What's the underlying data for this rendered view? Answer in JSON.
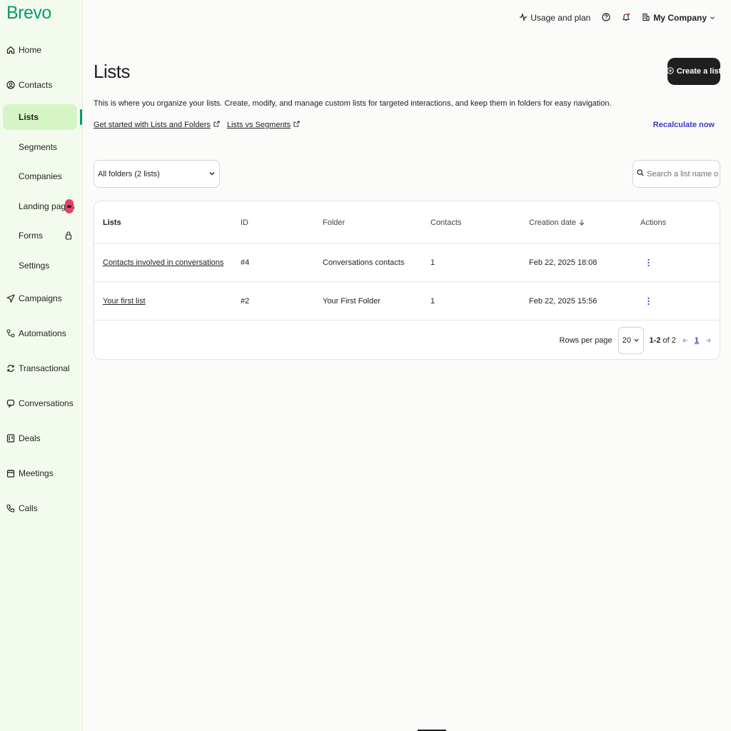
{
  "brand": {
    "logo_text": "Brevo",
    "accent": "#0b996e"
  },
  "sidebar": {
    "items": [
      {
        "label": "Home",
        "icon": "home-icon"
      },
      {
        "label": "Contacts",
        "icon": "contacts-icon"
      },
      {
        "label": "Campaigns",
        "icon": "send-icon"
      },
      {
        "label": "Automations",
        "icon": "automation-icon"
      },
      {
        "label": "Transactional",
        "icon": "refresh-icon"
      },
      {
        "label": "Conversations",
        "icon": "chat-icon"
      },
      {
        "label": "Deals",
        "icon": "deals-icon"
      },
      {
        "label": "Meetings",
        "icon": "calendar-icon"
      },
      {
        "label": "Calls",
        "icon": "phone-icon"
      }
    ],
    "contacts_sub": [
      {
        "label": "Lists",
        "active": true
      },
      {
        "label": "Segments"
      },
      {
        "label": "Companies"
      },
      {
        "label": "Landing pages",
        "badge": "crown-icon"
      },
      {
        "label": "Forms",
        "badge": "lock-icon"
      },
      {
        "label": "Settings"
      }
    ]
  },
  "topbar": {
    "usage_label": "Usage and plan",
    "help_icon": "help-icon",
    "bell_icon": "bell-icon",
    "company_label": "My Company"
  },
  "page": {
    "title": "Lists",
    "create_button": "Create a list",
    "description": "This is where you organize your lists. Create, modify, and manage custom lists for targeted interactions, and keep them in folders for easy navigation.",
    "link_getting_started": "Get started with Lists and Folders",
    "link_vs_segments": "Lists vs Segments",
    "recalculate": "Recalculate now",
    "folder_filter": "All folders (2 lists)",
    "search_placeholder": "Search a list name or ID"
  },
  "table": {
    "headers": [
      "Lists",
      "ID",
      "Folder",
      "Contacts",
      "Creation date",
      "Actions"
    ],
    "rows": [
      {
        "name": "Contacts involved in conversations",
        "id": "#4",
        "folder": "Conversations contacts",
        "contacts": "1",
        "created": "Feb 22, 2025 18:08"
      },
      {
        "name": "Your first list",
        "id": "#2",
        "folder": "Your First Folder",
        "contacts": "1",
        "created": "Feb 22, 2025 15:56"
      }
    ]
  },
  "pager": {
    "rows_label": "Rows per page",
    "rows_value": "20",
    "range": "1-2",
    "of_label": "of 2",
    "current_page": "1"
  }
}
